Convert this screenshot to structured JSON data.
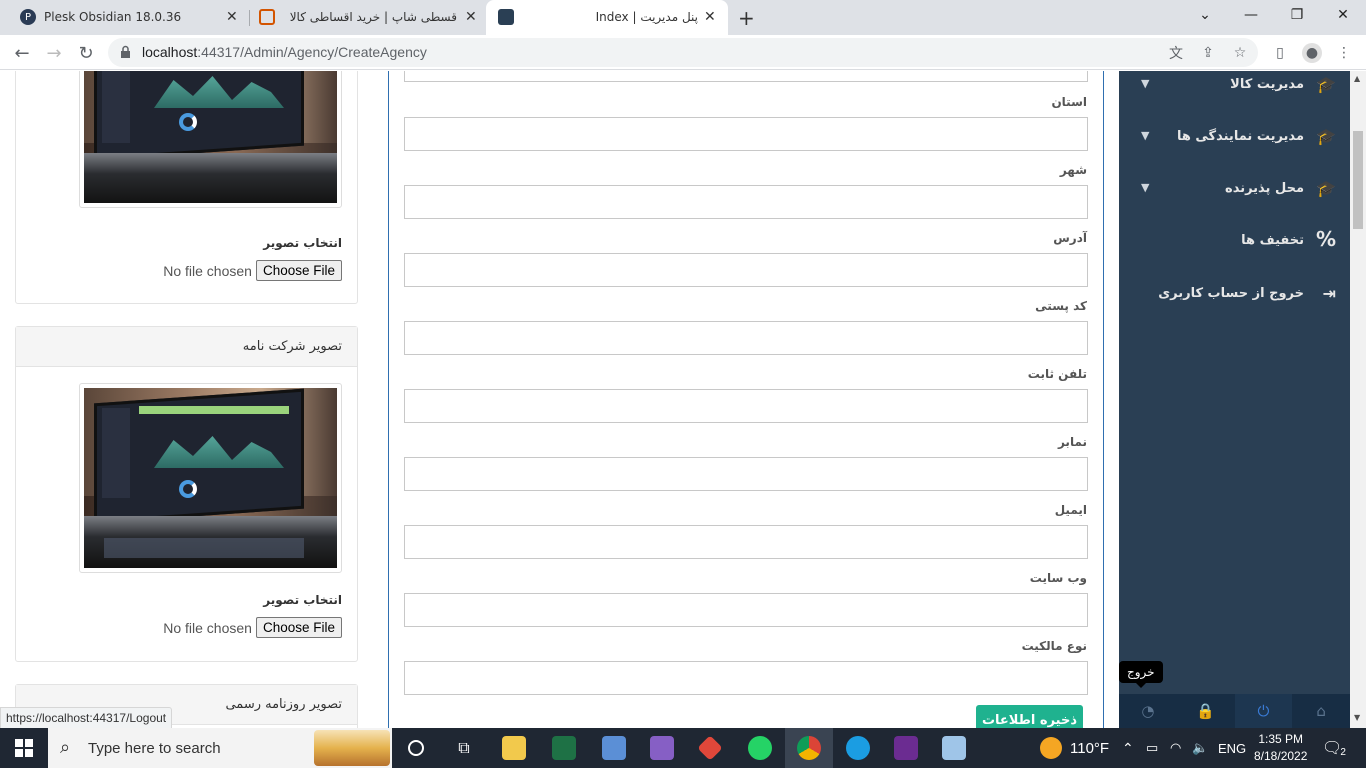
{
  "browser": {
    "tabs": [
      {
        "title": "Plesk Obsidian 18.0.36"
      },
      {
        "title": "قسطی شاپ | خرید اقساطی کالا"
      },
      {
        "title": "پنل مدیریت | Index"
      }
    ],
    "new_tab_label": "+",
    "url_host": "localhost",
    "url_path": ":44317/Admin/Agency/CreateAgency"
  },
  "left_cards": [
    {
      "header": "",
      "pick_label": "انتخاب تصویر",
      "no_file": "No file chosen",
      "choose": "Choose File"
    },
    {
      "header": "تصویر شرکت نامه",
      "pick_label": "انتخاب تصویر",
      "no_file": "No file chosen",
      "choose": "Choose File"
    },
    {
      "header": "تصویر روزنامه رسمی"
    }
  ],
  "form": {
    "fields": [
      {
        "label": "استان"
      },
      {
        "label": "شهر"
      },
      {
        "label": "آدرس"
      },
      {
        "label": "کد پستی"
      },
      {
        "label": "تلفن ثابت"
      },
      {
        "label": "نمابر"
      },
      {
        "label": "ایمیل"
      },
      {
        "label": "وب سایت"
      },
      {
        "label": "نوع مالکیت"
      }
    ],
    "save_label": "ذخیره اطلاعات"
  },
  "sidebar": {
    "items": [
      {
        "label": "مدیریت کالا",
        "icon": "graduation-cap-icon"
      },
      {
        "label": "مدیریت نمایندگی ها",
        "icon": "graduation-cap-icon"
      },
      {
        "label": "محل پذیرنده",
        "icon": "graduation-cap-icon"
      },
      {
        "label": "تخفیف ها",
        "icon": "percent-icon"
      },
      {
        "label": "خروج از حساب کاربری",
        "icon": "sign-out-icon"
      }
    ],
    "tooltip": "خروج"
  },
  "status_url": "https://localhost:44317/Logout",
  "taskbar": {
    "search_placeholder": "Type here to search",
    "weather": "110°F",
    "lang": "ENG",
    "time": "1:35 PM",
    "date": "8/18/2022",
    "notifications": "2"
  }
}
